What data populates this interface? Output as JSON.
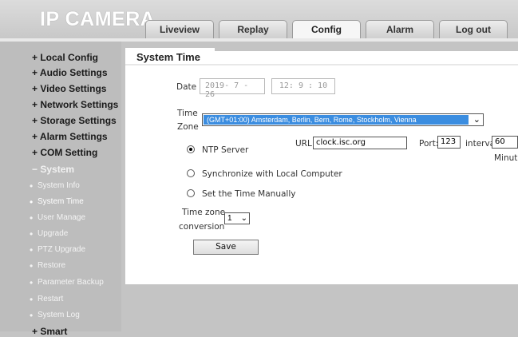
{
  "header": {
    "logo": "IP CAMERA",
    "tabs": [
      {
        "label": "Liveview"
      },
      {
        "label": "Replay"
      },
      {
        "label": "Config",
        "active": true
      },
      {
        "label": "Alarm"
      },
      {
        "label": "Log out"
      }
    ]
  },
  "sidebar": {
    "items": [
      {
        "label": "+ Local Config"
      },
      {
        "label": "+ Audio Settings"
      },
      {
        "label": "+ Video Settings"
      },
      {
        "label": "+ Network Settings"
      },
      {
        "label": "+ Storage Settings"
      },
      {
        "label": "+ Alarm Settings"
      },
      {
        "label": "+ COM Setting"
      },
      {
        "label": "− System"
      }
    ],
    "sub_items": [
      {
        "label": "System Info"
      },
      {
        "label": "System Time",
        "active": true
      },
      {
        "label": "User Manage"
      },
      {
        "label": "Upgrade"
      },
      {
        "label": "PTZ Upgrade"
      },
      {
        "label": "Restore"
      },
      {
        "label": "Parameter Backup"
      },
      {
        "label": "Restart"
      },
      {
        "label": "System Log"
      }
    ],
    "last_item": "+ Smart"
  },
  "panel": {
    "title": "System Time",
    "date_label": "Date",
    "date_value": "2019- 7 - 26",
    "time_value": "12: 9 : 10",
    "time_zone_label_1": "Time",
    "time_zone_label_2": "Zone",
    "time_zone_value": "(GMT+01:00) Amsterdam, Berlin, Bern, Rome, Stockholm, Vienna",
    "ntp_label": "NTP Server",
    "url_label": "URL:",
    "url_value": "clock.isc.org",
    "port_label": "Port:",
    "port_value": "123",
    "interval_label": "interval",
    "interval_value": "60",
    "minute_label": "Minute",
    "sync_label": "Synchronize with Local Computer",
    "manual_label": "Set the Time Manually",
    "tz_conv_label_1": "Time zone",
    "tz_conv_label_2": "conversion",
    "tz_conv_value": "1",
    "save_label": "Save"
  },
  "colors": {
    "selection": "#3b8de0",
    "sidebar_bg": "#bdbdbd",
    "header_bg": "#d0d0d0"
  }
}
